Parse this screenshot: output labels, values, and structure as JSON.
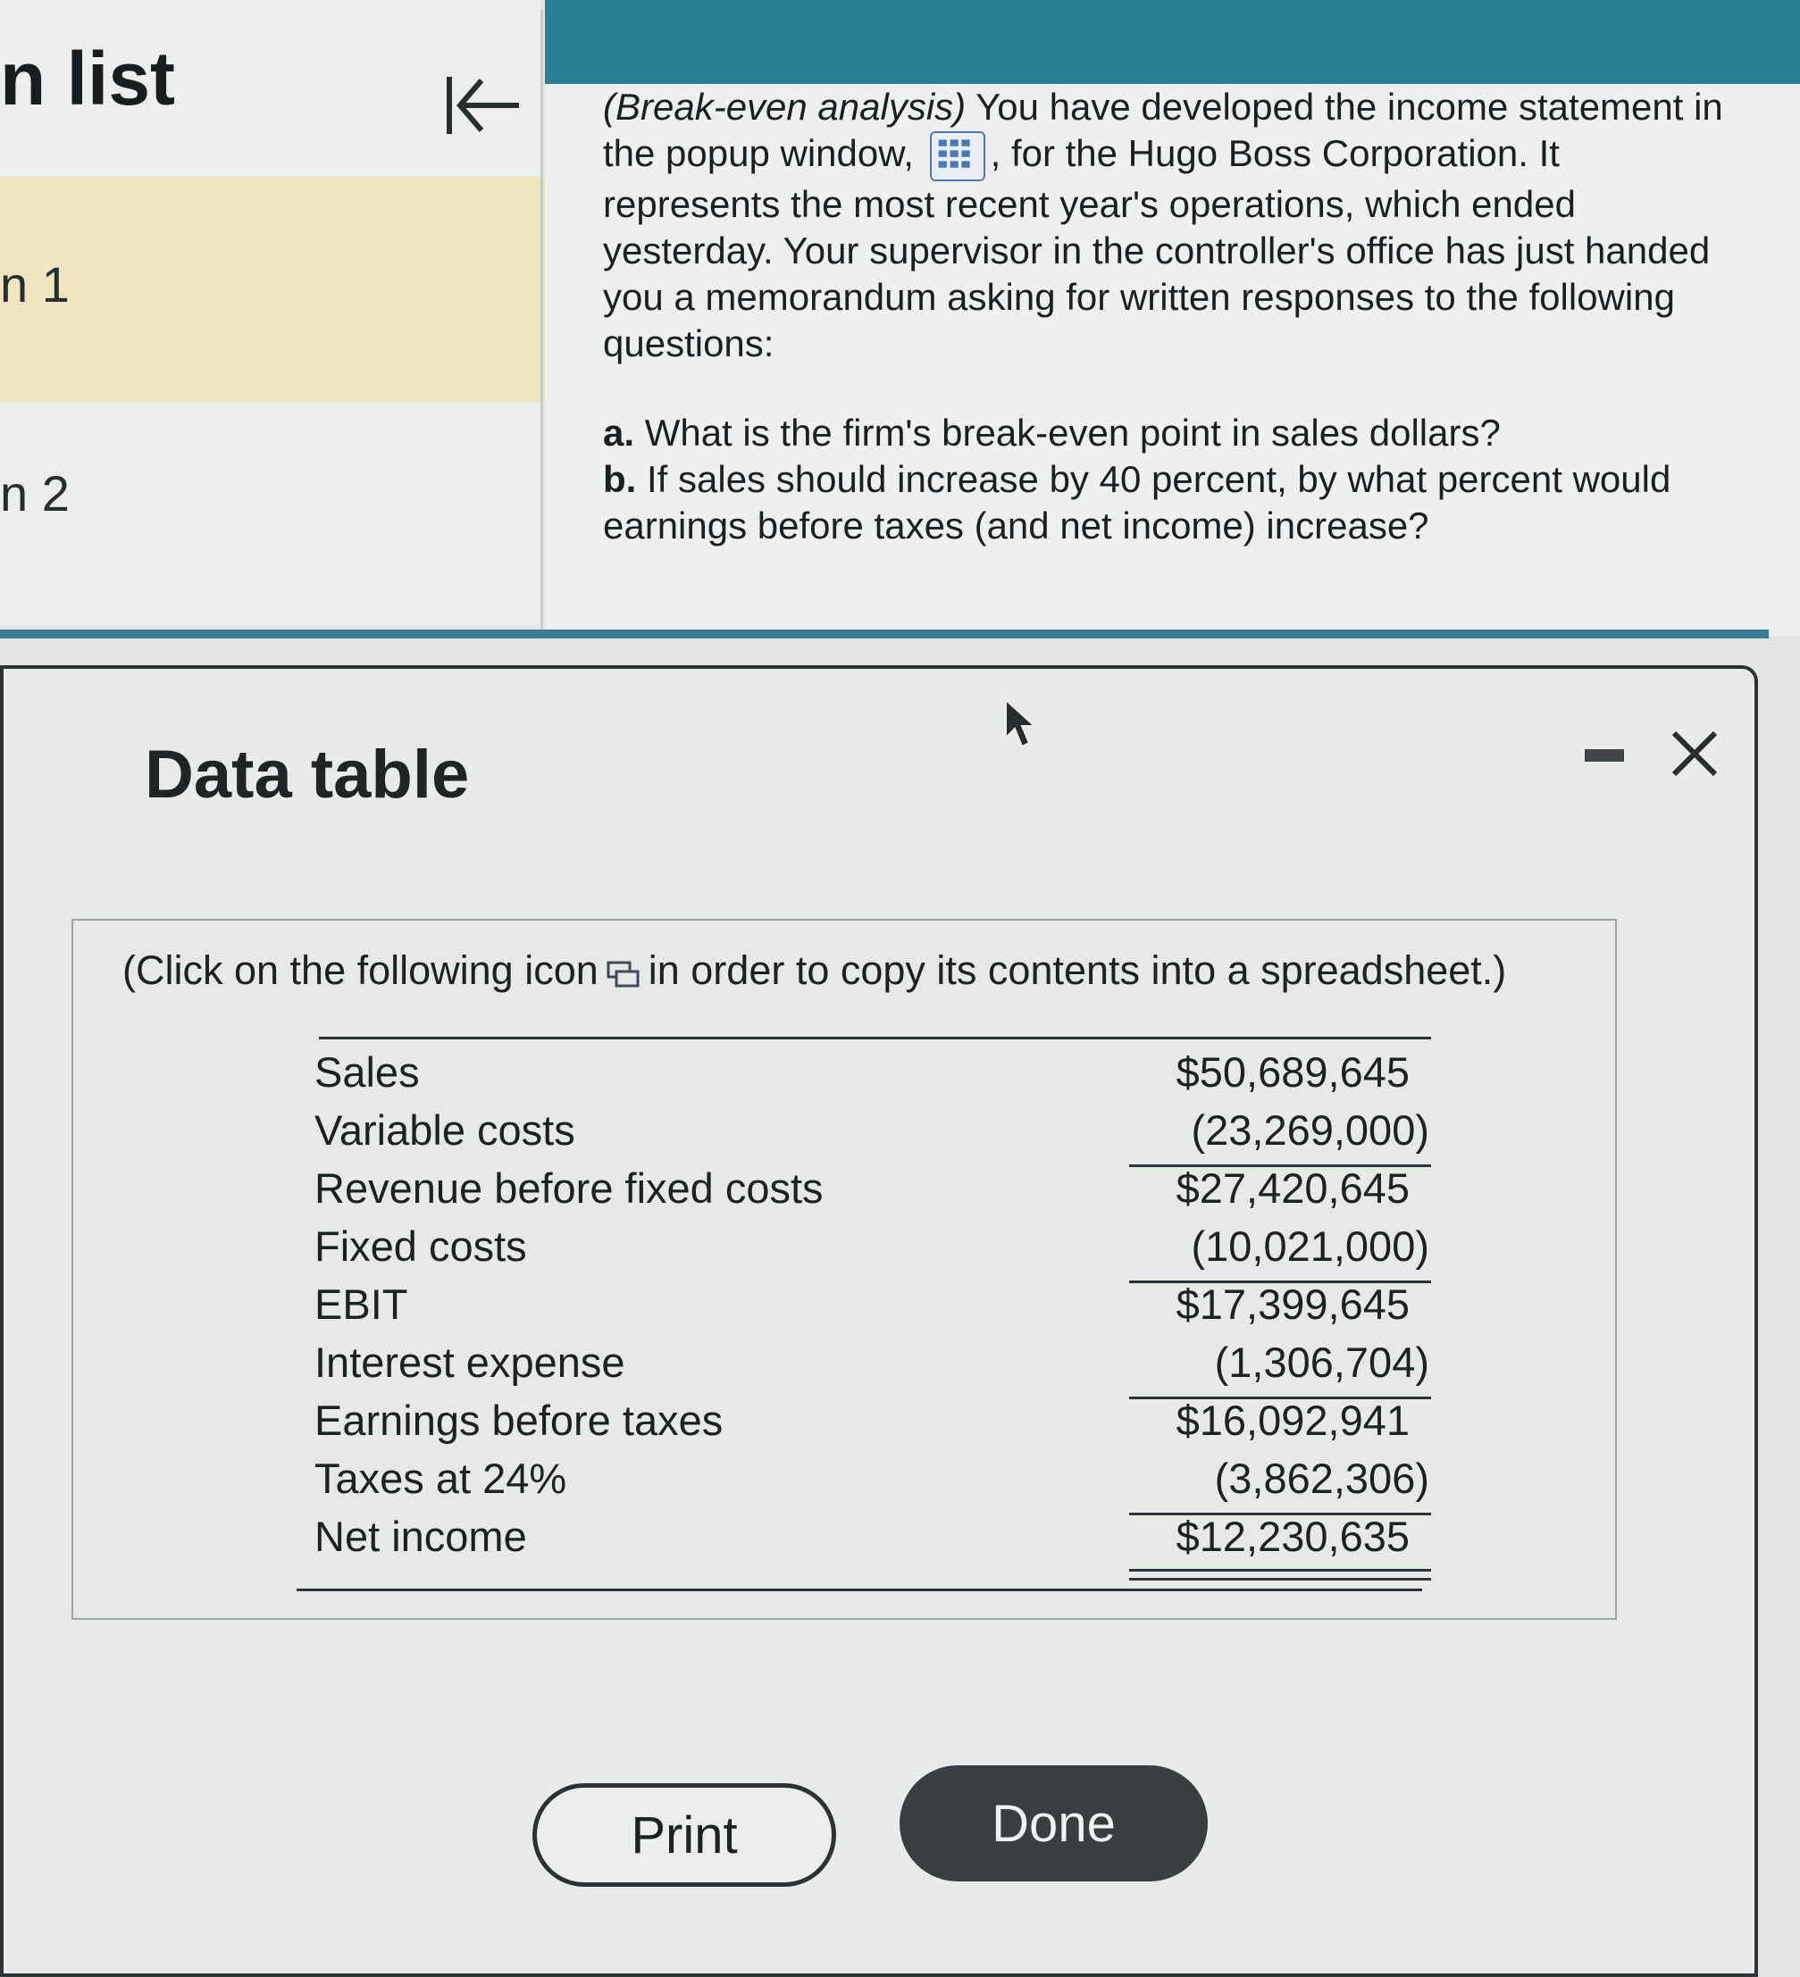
{
  "sidebar": {
    "title": "n list",
    "items": [
      {
        "label": "n 1"
      },
      {
        "label": "n 2"
      }
    ]
  },
  "question": {
    "intro_italic": "(Break-even analysis)",
    "intro_text_1": " You have developed the income statement in the popup window, ",
    "intro_text_2": ", for the Hugo Boss Corporation. It represents the most recent year's operations, which ended yesterday. Your supervisor in the controller's office has just handed you a memorandum asking for written responses to the following questions:",
    "part_a_label": "a.",
    "part_a_text": " What is the firm's break-even point in sales dollars?",
    "part_b_label": "b.",
    "part_b_text": " If sales should increase by 40 percent, by what percent would earnings before taxes (and net income) increase?"
  },
  "modal": {
    "title": "Data table",
    "copy_note_before": "(Click on the following icon",
    "copy_note_after": "in order to copy its contents into a spreadsheet.)",
    "rows": [
      {
        "label": "Sales",
        "value": "$50,689,645"
      },
      {
        "label": "Variable costs",
        "value": "(23,269,000)"
      },
      {
        "label": "Revenue before fixed costs",
        "value": "$27,420,645"
      },
      {
        "label": "Fixed costs",
        "value": "(10,021,000)"
      },
      {
        "label": "EBIT",
        "value": "$17,399,645"
      },
      {
        "label": "Interest expense",
        "value": "(1,306,704)"
      },
      {
        "label": "Earnings before taxes",
        "value": "$16,092,941"
      },
      {
        "label": "Taxes at 24%",
        "value": "(3,862,306)"
      },
      {
        "label": "Net income",
        "value": "$12,230,635"
      }
    ],
    "print_label": "Print",
    "done_label": "Done"
  },
  "colors": {
    "top_bar": "#2b7f95",
    "selected_item": "#efe5be",
    "done_button": "#393e41"
  }
}
